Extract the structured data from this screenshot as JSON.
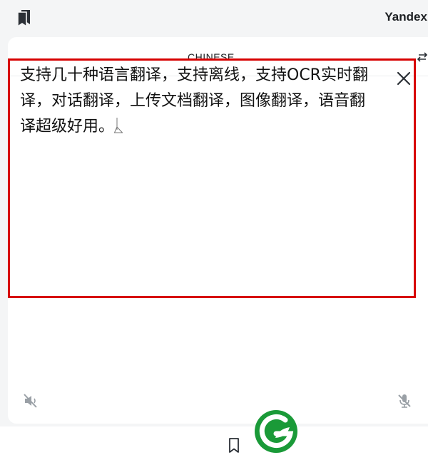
{
  "header": {
    "app_title": "Yandex T",
    "bookmark_icon": "bookmark-filled-icon"
  },
  "translator": {
    "source_language": "CHINESE",
    "swap_icon": "swap-languages-icon",
    "source_text": "支持几十种语言翻译，支持离线，支持OCR实时翻译，对话翻译，上传文档翻译，图像翻译，语音翻译超级好用。",
    "clear_icon": "close-icon",
    "mute_icon": "speaker-muted-icon",
    "mic_icon": "microphone-off-icon"
  },
  "bottom_nav": {
    "bookmark_icon": "bookmark-outline-icon",
    "logo_icon": "green-g-logo-icon"
  },
  "colors": {
    "highlight_border": "#d70000",
    "logo_green": "#1a9a38",
    "text_dark": "#1c1f22",
    "icon_gray": "#9aa0a6"
  }
}
